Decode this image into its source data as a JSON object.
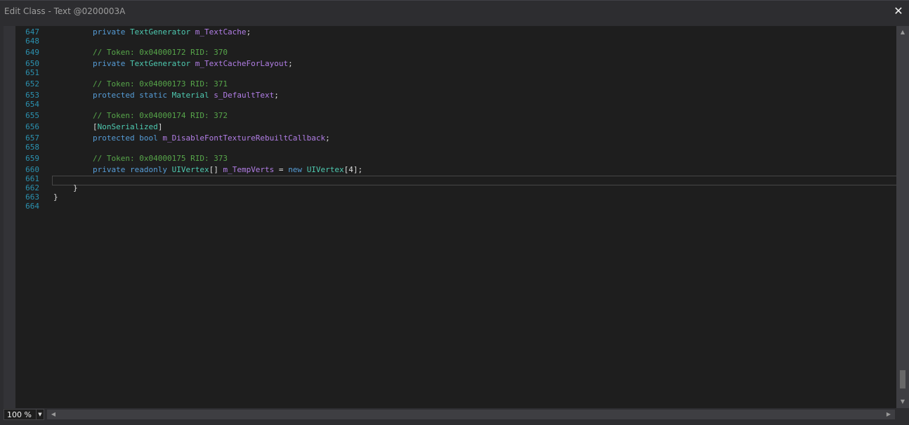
{
  "window": {
    "title": "Edit Class - Text @0200003A"
  },
  "editor": {
    "lines": [
      {
        "n": "647",
        "tokens": [
          [
            "k",
            "private "
          ],
          [
            "t",
            "TextGenerator "
          ],
          [
            "f",
            "m_TextCache"
          ],
          [
            "p",
            ";"
          ]
        ]
      },
      {
        "n": "648",
        "tokens": []
      },
      {
        "n": "649",
        "tokens": [
          [
            "c",
            "// Token: 0x04000172 RID: 370"
          ]
        ]
      },
      {
        "n": "650",
        "tokens": [
          [
            "k",
            "private "
          ],
          [
            "t",
            "TextGenerator "
          ],
          [
            "f",
            "m_TextCacheForLayout"
          ],
          [
            "p",
            ";"
          ]
        ]
      },
      {
        "n": "651",
        "tokens": []
      },
      {
        "n": "652",
        "tokens": [
          [
            "c",
            "// Token: 0x04000173 RID: 371"
          ]
        ]
      },
      {
        "n": "653",
        "tokens": [
          [
            "k",
            "protected static "
          ],
          [
            "t",
            "Material "
          ],
          [
            "f",
            "s_DefaultText"
          ],
          [
            "p",
            ";"
          ]
        ]
      },
      {
        "n": "654",
        "tokens": []
      },
      {
        "n": "655",
        "tokens": [
          [
            "c",
            "// Token: 0x04000174 RID: 372"
          ]
        ]
      },
      {
        "n": "656",
        "tokens": [
          [
            "p",
            "["
          ],
          [
            "t",
            "NonSerialized"
          ],
          [
            "p",
            "]"
          ]
        ]
      },
      {
        "n": "657",
        "tokens": [
          [
            "k",
            "protected bool "
          ],
          [
            "f",
            "m_DisableFontTextureRebuiltCallback"
          ],
          [
            "p",
            ";"
          ]
        ]
      },
      {
        "n": "658",
        "tokens": []
      },
      {
        "n": "659",
        "tokens": [
          [
            "c",
            "// Token: 0x04000175 RID: 373"
          ]
        ]
      },
      {
        "n": "660",
        "tokens": [
          [
            "k",
            "private readonly "
          ],
          [
            "t",
            "UIVertex"
          ],
          [
            "p",
            "[] "
          ],
          [
            "f",
            "m_TempVerts"
          ],
          [
            "p",
            " = "
          ],
          [
            "k",
            "new "
          ],
          [
            "t",
            "UIVertex"
          ],
          [
            "p",
            "[4];"
          ]
        ]
      },
      {
        "n": "661",
        "tokens": []
      },
      {
        "n": "662",
        "tokens": [
          [
            "p",
            "}"
          ]
        ]
      },
      {
        "n": "663",
        "tokens": [
          [
            "p",
            "}"
          ]
        ]
      },
      {
        "n": "664",
        "tokens": []
      }
    ],
    "indents": [
      8,
      0,
      8,
      8,
      0,
      8,
      8,
      0,
      8,
      8,
      8,
      0,
      8,
      8,
      0,
      4,
      0,
      0
    ],
    "current_line": "661"
  },
  "zoom": {
    "value": "100 %"
  },
  "icons": {
    "close": "close-icon",
    "scroll_up": "scroll-up-icon",
    "scroll_down": "scroll-down-icon",
    "dropdown": "chevron-down-icon"
  }
}
